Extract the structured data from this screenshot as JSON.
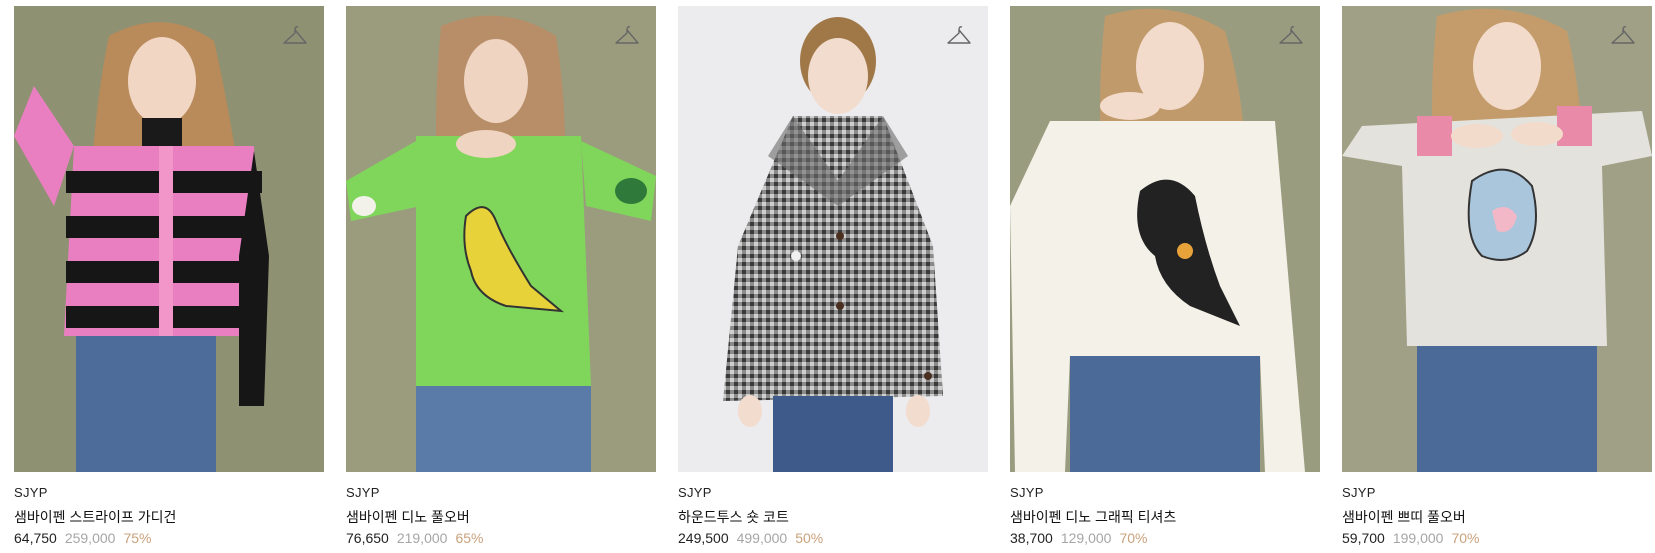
{
  "products": [
    {
      "brand": "SJYP",
      "name": "샘바이펜 스트라이프 가디건",
      "price": "64,750",
      "original_price": "259,000",
      "discount": "75%",
      "background_color": "#8f9173",
      "garment_color": "#e97fc0",
      "wishlist_icon": "hanger-icon"
    },
    {
      "brand": "SJYP",
      "name": "샘바이펜 디노 풀오버",
      "price": "76,650",
      "original_price": "219,000",
      "discount": "65%",
      "background_color": "#9b9c7d",
      "garment_color": "#7fd65a",
      "wishlist_icon": "hanger-icon"
    },
    {
      "brand": "SJYP",
      "name": "하운드투스 숏 코트",
      "price": "249,500",
      "original_price": "499,000",
      "discount": "50%",
      "background_color": "#ecebee",
      "garment_color": "#6a6a6a",
      "wishlist_icon": "hanger-icon"
    },
    {
      "brand": "SJYP",
      "name": "샘바이펜 디노 그래픽 티셔츠",
      "price": "38,700",
      "original_price": "129,000",
      "discount": "70%",
      "background_color": "#9a9c80",
      "garment_color": "#f3f1e8",
      "wishlist_icon": "hanger-icon"
    },
    {
      "brand": "SJYP",
      "name": "샘바이펜 쁘띠 풀오버",
      "price": "59,700",
      "original_price": "199,000",
      "discount": "70%",
      "background_color": "#9fa085",
      "garment_color": "#e4e2dd",
      "wishlist_icon": "hanger-icon"
    }
  ],
  "colors": {
    "price": "#222222",
    "original_price": "#a6a6a6",
    "discount": "#c9a27c"
  }
}
